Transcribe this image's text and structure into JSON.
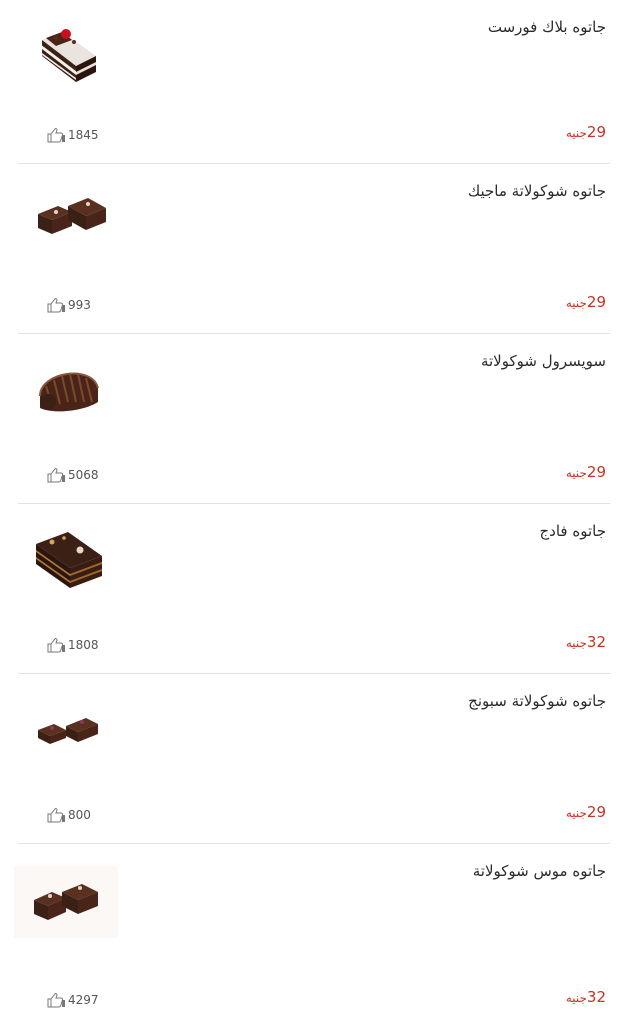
{
  "currency": "جنيه",
  "items": [
    {
      "title": "جاتوه بلاك فورست",
      "price": "29",
      "likes": "1845",
      "image": "black-forest-cake-icon"
    },
    {
      "title": "جاتوه شوكولاتة ماجيك",
      "price": "29",
      "likes": "993",
      "image": "chocolate-magic-cake-icon"
    },
    {
      "title": "سويسرول شوكولاتة",
      "price": "29",
      "likes": "5068",
      "image": "swiss-roll-icon"
    },
    {
      "title": "جاتوه فادج",
      "price": "32",
      "likes": "1808",
      "image": "fudge-cake-icon"
    },
    {
      "title": "جاتوه شوكولاتة سبونج",
      "price": "29",
      "likes": "800",
      "image": "chocolate-sponge-cake-icon"
    },
    {
      "title": "جاتوه موس شوكولاتة",
      "price": "32",
      "likes": "4297",
      "image": "chocolate-mousse-cake-icon"
    }
  ],
  "colors": {
    "price": "#c8321f",
    "divider": "#e2e2e2",
    "cake_dark": "#3b2016",
    "cake_mid": "#5a3020"
  }
}
